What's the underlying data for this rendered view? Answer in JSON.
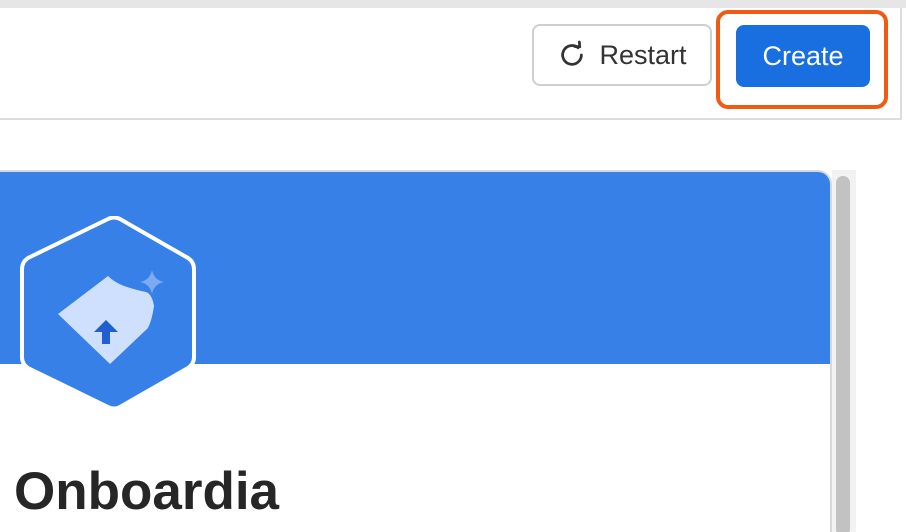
{
  "toolbar": {
    "restart_label": "Restart",
    "create_label": "Create",
    "restart_icon": "refresh-icon"
  },
  "app": {
    "name": "Onboardia",
    "logo_icon": "hexagon-logo-icon"
  },
  "colors": {
    "banner": "#3680e7",
    "primary_button": "#1a6fe0",
    "highlight": "#f05a14",
    "title_text": "#262626"
  }
}
